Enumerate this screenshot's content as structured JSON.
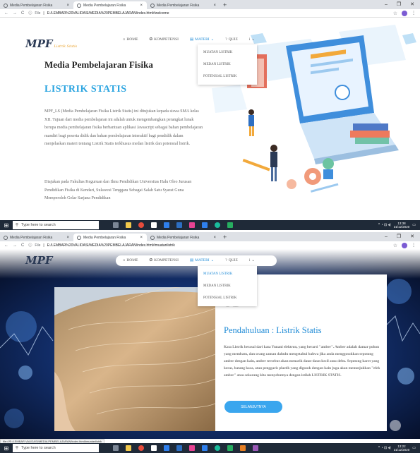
{
  "screen1": {
    "tabs": [
      {
        "title": "Media Pembelajaran Fisika",
        "active": false
      },
      {
        "title": "Media Pembelajaran Fisika",
        "active": true
      },
      {
        "title": "Media Pembelajaran Fisika",
        "active": false
      }
    ],
    "url": "E:/LEMBAR%20VALIDASI/MEDIA%20PEMBELAJARAN/index.html#welcome",
    "logo": {
      "text": "MPF",
      "sub": "Listrik Statis"
    },
    "nav": [
      "HOME",
      "KOMPETENSI",
      "MATERI",
      "QUIZ",
      "i"
    ],
    "dropdown": [
      "MUATAN LISTRIK",
      "MEDAN LISTRIK",
      "POTENSIAL LISTRIK"
    ],
    "heading": "Media Pembelajaran Fisika",
    "subheading": "LISTRIK STATIS",
    "paragraph1": "MPF_LS (Media Pembelajaran Fisika Listrik Statis) ini ditujukan kepada siswa SMA kelas XII. Tujuan dari media pembelajaran ini adalah untuk mengembangkan perangkat lunak berupa media pembelajaran fisika berbantuan aplikasi Javascript sebagai bahan pembelajaran mandiri bagi peserta didik dan bahan pembelajaran interaktif bagi pendidik dalam menjelaskan materi tentang Listrik Statis terkhusus medan listrik dan potensial listrik.",
    "paragraph2": "Diajukan pada Fakultas Keguruan dan Ilmu Pendidikan Universitas Halu Oleo Jurusan Pendidikan Fisika di Kendari, Sulawesi Tenggara Sebagai Salah Satu Syarat Guna Memperoleh Gelar Sarjana Pendidikan",
    "taskbar": {
      "search": "Type here to search",
      "time": "13:38",
      "date": "31/12/2020"
    }
  },
  "screen2": {
    "tabs": [
      {
        "title": "Media Pembelajaran Fisika",
        "active": false
      },
      {
        "title": "Media Pembelajaran Fisika",
        "active": true
      },
      {
        "title": "Media Pembelajaran Fisika",
        "active": false
      }
    ],
    "url": "E:/LEMBAR%20VALIDASI/MEDIA%20PEMBELAJARAN/index.html#muatanlistrik",
    "logo": {
      "text": "MPF"
    },
    "nav": [
      "HOME",
      "KOMPETENSI",
      "MATERI",
      "QUIZ",
      "i"
    ],
    "dropdown": [
      "MUATAN LISTRIK",
      "MEDAN LISTRIK",
      "POTENSIAL LISTRIK"
    ],
    "card": {
      "number": "01",
      "title": "Pendahuluan : Listrik Statis",
      "body": "Kata Listrik berasal dari kata Yunani elektron, yang berarti \"amber\". Amber adalah damar pohon yang membatu, dan orang zaman dahulu mengetahui bahwa jika anda menggosokkan sepotong amber dengan kain, amber tersebut akan menarik daun-daun kecil atau debu. Sepotong karet yang keras, batang kaca, atau penggaris plastik yang digosok dengan kain juga akan menunjukkan \"efek amber\" atau sekarang kita menyebutnya dengan istilah LISTRIK STATIS.",
      "button": "SELANJUTNYA"
    },
    "status_url": "file:///E:/LEMBAR VALIDASI/MEDIA PEMBELAJARAN/index.html#muatanlistrik",
    "taskbar": {
      "search": "Type here to search",
      "time": "13:22",
      "date": "31/12/2020"
    }
  },
  "file_label": "File",
  "colors": {
    "accent": "#1f8bd6",
    "subheading": "#2aa4e0",
    "button": "#3aa6ee",
    "taskbar": "#1f2a38"
  },
  "icons": [
    "back-icon",
    "forward-icon",
    "reload-icon",
    "info-icon",
    "star-icon",
    "profile-icon",
    "windows-icon",
    "search-icon",
    "home-icon",
    "medal-icon",
    "book-icon",
    "quiz-icon",
    "info-icon"
  ]
}
